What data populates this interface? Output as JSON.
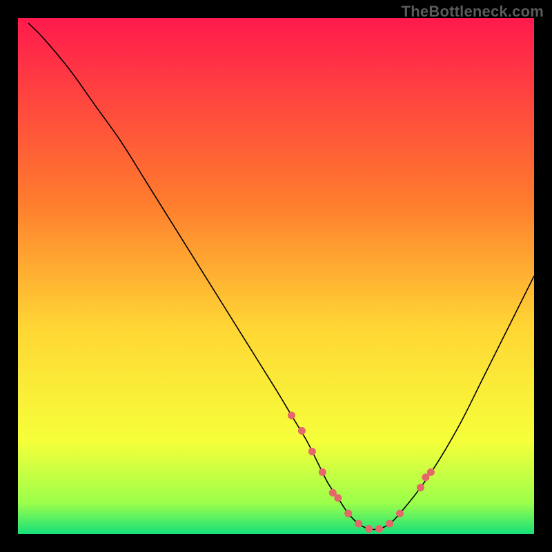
{
  "watermark": "TheBottleneck.com",
  "chart_data": {
    "type": "line",
    "title": "",
    "xlabel": "",
    "ylabel": "",
    "xlim": [
      0,
      100
    ],
    "ylim": [
      0,
      100
    ],
    "grid": false,
    "legend": false,
    "background_gradient": {
      "stops": [
        {
          "offset": 0.0,
          "color": "#ff1a4d"
        },
        {
          "offset": 0.35,
          "color": "#ff7a2e"
        },
        {
          "offset": 0.6,
          "color": "#ffd634"
        },
        {
          "offset": 0.82,
          "color": "#f6ff3a"
        },
        {
          "offset": 0.94,
          "color": "#9bff4a"
        },
        {
          "offset": 1.0,
          "color": "#16e07a"
        }
      ]
    },
    "series": [
      {
        "name": "bottleneck-curve",
        "stroke": "#000000",
        "stroke_width": 1.6,
        "x": [
          2,
          5,
          10,
          15,
          20,
          25,
          30,
          35,
          40,
          45,
          50,
          53,
          56,
          58,
          60,
          62,
          64,
          66,
          68,
          70,
          72,
          74,
          78,
          82,
          86,
          90,
          94,
          98,
          100
        ],
        "y": [
          99,
          96,
          90,
          83,
          76,
          68,
          60,
          52,
          44,
          36,
          28,
          23,
          18,
          14,
          10,
          7,
          4,
          2,
          1,
          1,
          2,
          4,
          9,
          15,
          22,
          30,
          38,
          46,
          50
        ]
      }
    ],
    "markers": {
      "name": "highlight-points",
      "fill": "#e4686a",
      "radius": 5.5,
      "x": [
        53,
        55,
        57,
        59,
        61,
        62,
        64,
        66,
        68,
        70,
        72,
        74,
        78,
        79,
        80
      ],
      "y": [
        23,
        20,
        16,
        12,
        8,
        7,
        4,
        2,
        1,
        1,
        2,
        4,
        9,
        11,
        12
      ]
    }
  }
}
